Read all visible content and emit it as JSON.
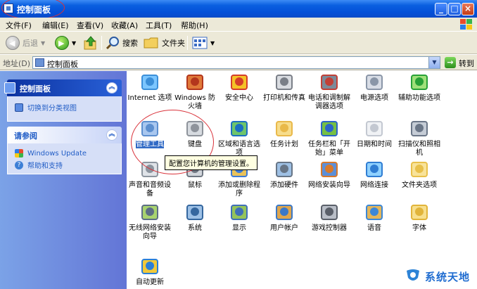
{
  "window": {
    "title": "控制面板"
  },
  "menu": [
    "文件(F)",
    "编辑(E)",
    "查看(V)",
    "收藏(A)",
    "工具(T)",
    "帮助(H)"
  ],
  "toolbar": {
    "back": "后退",
    "search": "搜索",
    "folders": "文件夹"
  },
  "address": {
    "label": "地址(D)",
    "value": "控制面板",
    "go": "转到"
  },
  "sidebar": {
    "control_panel": {
      "title": "控制面板",
      "switch_view": "切换到分类视图"
    },
    "see_also": {
      "title": "请参阅",
      "links": [
        "Windows Update",
        "帮助和支持"
      ]
    }
  },
  "items": [
    {
      "label": "Internet 选项",
      "icon": "internet-options-icon"
    },
    {
      "label": "Windows 防火墙",
      "icon": "firewall-icon"
    },
    {
      "label": "安全中心",
      "icon": "security-center-icon"
    },
    {
      "label": "打印机和传真",
      "icon": "printers-icon"
    },
    {
      "label": "电话和调制解调器选项",
      "icon": "phone-modem-icon"
    },
    {
      "label": "电源选项",
      "icon": "power-options-icon"
    },
    {
      "label": "辅助功能选项",
      "icon": "accessibility-icon"
    },
    {
      "label": "管理工具",
      "icon": "admin-tools-icon"
    },
    {
      "label": "键盘",
      "icon": "keyboard-icon"
    },
    {
      "label": "区域和语言选项",
      "icon": "region-language-icon"
    },
    {
      "label": "任务计划",
      "icon": "scheduled-tasks-icon"
    },
    {
      "label": "任务栏和「开始」菜单",
      "icon": "taskbar-start-icon"
    },
    {
      "label": "日期和时间",
      "icon": "date-time-icon"
    },
    {
      "label": "扫描仪和照相机",
      "icon": "scanner-camera-icon"
    },
    {
      "label": "声音和音频设备",
      "icon": "sound-audio-icon"
    },
    {
      "label": "鼠标",
      "icon": "mouse-icon"
    },
    {
      "label": "添加或删除程序",
      "icon": "add-remove-programs-icon"
    },
    {
      "label": "添加硬件",
      "icon": "add-hardware-icon"
    },
    {
      "label": "网络安装向导",
      "icon": "network-setup-icon"
    },
    {
      "label": "网络连接",
      "icon": "network-connections-icon"
    },
    {
      "label": "文件夹选项",
      "icon": "folder-options-icon"
    },
    {
      "label": "无线网络安装向导",
      "icon": "wireless-setup-icon"
    },
    {
      "label": "系统",
      "icon": "system-icon"
    },
    {
      "label": "显示",
      "icon": "display-icon"
    },
    {
      "label": "用户帐户",
      "icon": "user-accounts-icon"
    },
    {
      "label": "游戏控制器",
      "icon": "game-controllers-icon"
    },
    {
      "label": "语音",
      "icon": "speech-icon"
    },
    {
      "label": "字体",
      "icon": "fonts-icon"
    },
    {
      "label": "自动更新",
      "icon": "automatic-updates-icon"
    }
  ],
  "tooltip": "配置您计算机的管理设置。",
  "watermark": "系统天地",
  "colors": {
    "title_bar": "#0a5fe0",
    "selection": "#316ac5",
    "sidebar": "#6f8fde",
    "annotation": "#d9323a"
  }
}
